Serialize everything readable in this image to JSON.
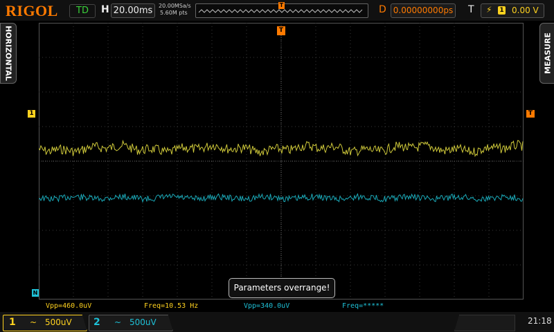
{
  "brand": "RIGOL",
  "status": {
    "run_state": "TD"
  },
  "horizontal": {
    "label": "H",
    "timebase": "20.00ms",
    "sample_rate": "20.00MSa/s",
    "memory_depth": "5.60M pts"
  },
  "delay": {
    "label": "D",
    "value": "0.00000000ps"
  },
  "trigger": {
    "label": "T",
    "source": "1",
    "level": "0.00 V",
    "edge_icon": "rising-edge-icon",
    "position_marker": "T"
  },
  "side_tabs": {
    "left": "HORIZONTAL",
    "right": "MEASURE"
  },
  "markers": {
    "ch1": "1",
    "ch2": "N",
    "trig_level": "T",
    "trig_top": "T"
  },
  "message": "Parameters overrange!",
  "measurements": {
    "ch1_vpp": "Vpp=460.0uV",
    "ch1_freq": "Freq=10.53 Hz",
    "ch2_vpp": "Vpp=340.0uV",
    "ch2_freq": "Freq=*****"
  },
  "channels": [
    {
      "number": "1",
      "coupling": "~",
      "scale": "500uV",
      "color": "#ffd21f"
    },
    {
      "number": "2",
      "coupling": "~",
      "scale": "500uV",
      "color": "#1ec0d6"
    }
  ],
  "clock": "21:18",
  "colors": {
    "ch1": "#ffd21f",
    "ch2": "#1ec0d6",
    "accent": "#ff7a00",
    "run": "#3ad13a"
  }
}
